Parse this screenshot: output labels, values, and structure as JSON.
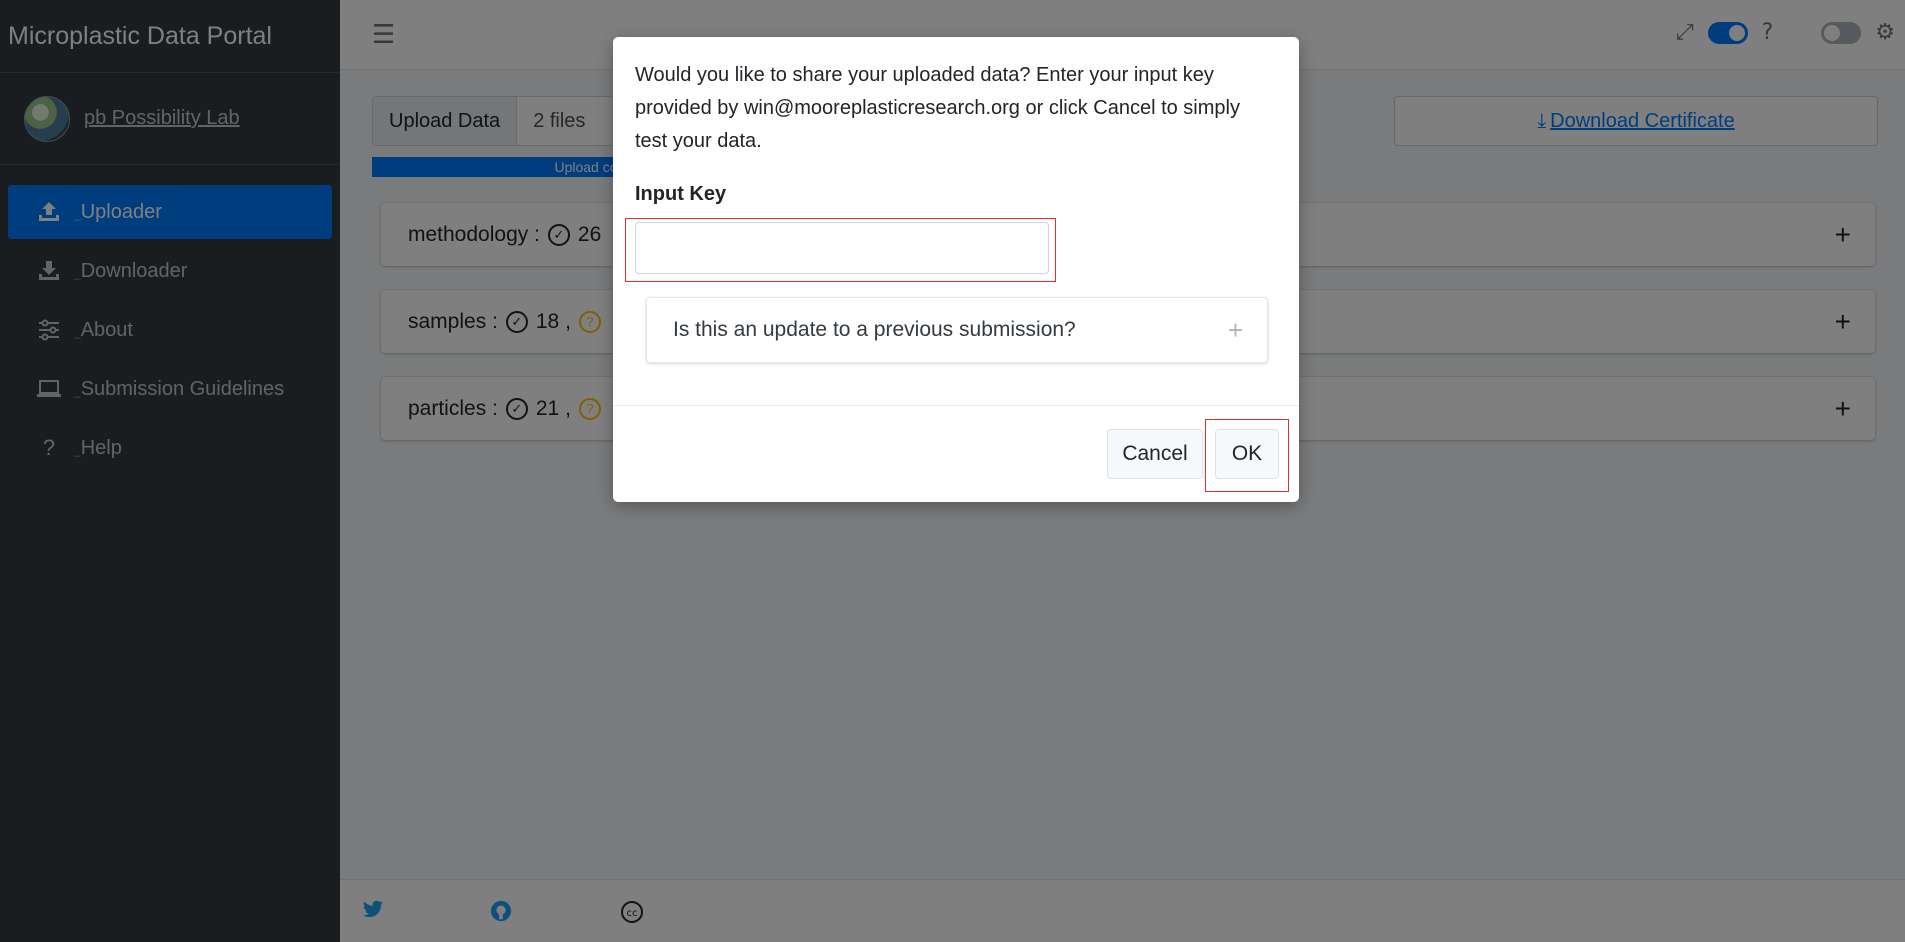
{
  "brand": {
    "title": "Microplastic Data Portal"
  },
  "user": {
    "name": "pb Possibility Lab"
  },
  "sidebar": {
    "items": [
      {
        "label": "Uploader",
        "icon": "upload-icon",
        "active": true
      },
      {
        "label": "Downloader",
        "icon": "download-icon",
        "active": false
      },
      {
        "label": "About",
        "icon": "sliders-icon",
        "active": false
      },
      {
        "label": "Submission Guidelines",
        "icon": "laptop-icon",
        "active": false
      },
      {
        "label": "Help",
        "icon": "question-icon",
        "active": false
      }
    ]
  },
  "upload": {
    "button_label": "Upload Data",
    "file_count": "2 files",
    "progress_text": "Upload complete",
    "progress_percent": 100
  },
  "certificate": {
    "label": "Download Certificate"
  },
  "cards": [
    {
      "name": "methodology",
      "prefix": "methodology :",
      "ok_count": "26"
    },
    {
      "name": "samples",
      "prefix": "samples :",
      "ok_count": "18 ,"
    },
    {
      "name": "particles",
      "prefix": "particles :",
      "ok_count": "21 ,"
    }
  ],
  "modal": {
    "message": "Would you like to share your uploaded data? Enter your input key provided by win@mooreplasticresearch.org or click Cancel to simply test your data.",
    "input_label": "Input Key",
    "input_value": "",
    "update_question": "Is this an update to a previous submission?",
    "cancel_label": "Cancel",
    "ok_label": "OK"
  },
  "colors": {
    "primary": "#007bff",
    "sidebar_bg": "#343a40",
    "warning": "#ffc107",
    "highlight": "#e03030"
  }
}
